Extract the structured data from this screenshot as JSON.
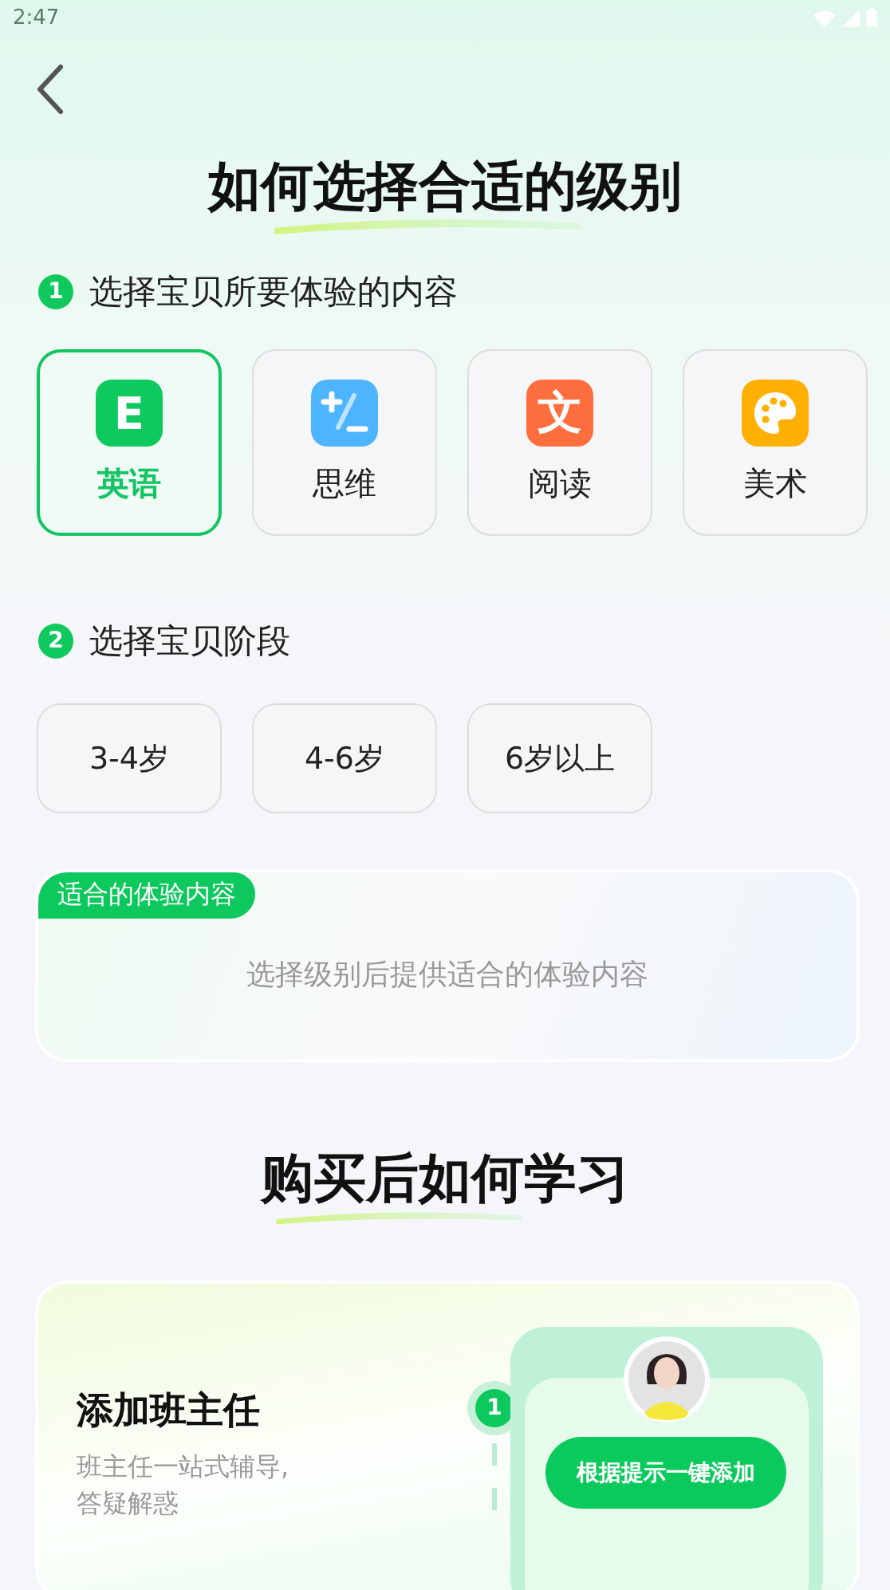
{
  "status_bar": {
    "time": "2:47"
  },
  "title": "如何选择合适的级别",
  "step1": {
    "number": "1",
    "label": "选择宝贝所要体验的内容"
  },
  "subjects": [
    {
      "kind": "english",
      "label": "英语",
      "icon_text": "E",
      "selected": true
    },
    {
      "kind": "thinking",
      "label": "思维",
      "selected": false
    },
    {
      "kind": "reading",
      "label": "阅读",
      "icon_text": "文",
      "selected": false
    },
    {
      "kind": "art",
      "label": "美术",
      "selected": false
    }
  ],
  "step2": {
    "number": "2",
    "label": "选择宝贝阶段"
  },
  "ages": [
    {
      "label": "3-4岁",
      "selected": false
    },
    {
      "label": "4-6岁",
      "selected": false
    },
    {
      "label": "6岁以上",
      "selected": false
    }
  ],
  "suggestion": {
    "tag": "适合的体验内容",
    "placeholder": "选择级别后提供适合的体验内容"
  },
  "title2": "购买后如何学习",
  "learn_step": {
    "title": "添加班主任",
    "description": "班主任一站式辅导,\n答疑解惑",
    "number": "1",
    "button": "根据提示一键添加"
  }
}
